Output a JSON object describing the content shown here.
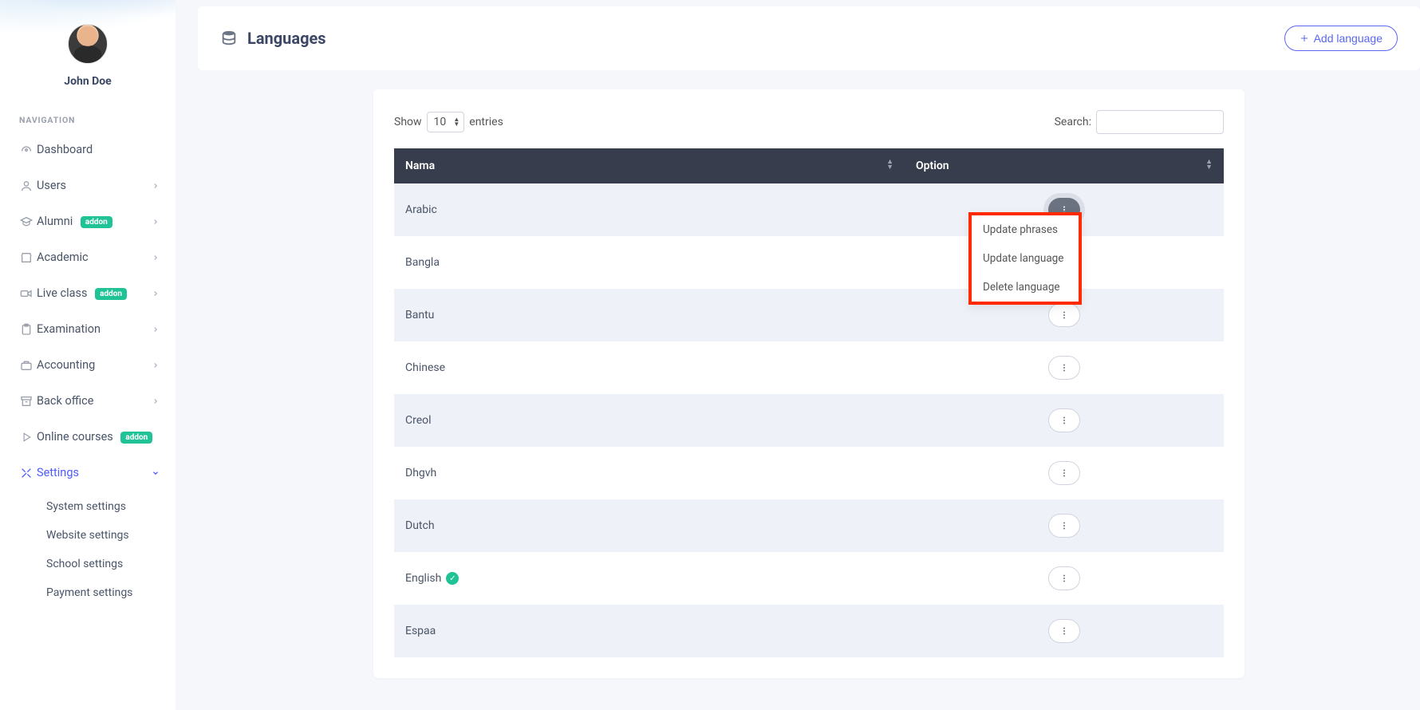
{
  "profile": {
    "name": "John Doe"
  },
  "navHeading": "NAVIGATION",
  "addonText": "addon",
  "nav": {
    "dashboard": "Dashboard",
    "users": "Users",
    "alumni": "Alumni",
    "academic": "Academic",
    "liveClass": "Live class",
    "examination": "Examination",
    "accounting": "Accounting",
    "backOffice": "Back office",
    "onlineCourses": "Online courses",
    "settings": "Settings"
  },
  "subnav": {
    "system": "System settings",
    "website": "Website settings",
    "school": "School settings",
    "payment": "Payment settings"
  },
  "header": {
    "title": "Languages",
    "addButton": "Add language"
  },
  "tableControls": {
    "showLabel": "Show",
    "entriesLabel": "entries",
    "lengthValue": "10",
    "searchLabel": "Search:"
  },
  "columns": {
    "name": "Nama",
    "option": "Option"
  },
  "dropdown": {
    "updatePhrases": "Update phrases",
    "updateLanguage": "Update language",
    "deleteLanguage": "Delete language"
  },
  "rows": [
    {
      "name": "Arabic",
      "default": false,
      "open": true
    },
    {
      "name": "Bangla",
      "default": false,
      "open": false
    },
    {
      "name": "Bantu",
      "default": false,
      "open": false
    },
    {
      "name": "Chinese",
      "default": false,
      "open": false
    },
    {
      "name": "Creol",
      "default": false,
      "open": false
    },
    {
      "name": "Dhgvh",
      "default": false,
      "open": false
    },
    {
      "name": "Dutch",
      "default": false,
      "open": false
    },
    {
      "name": "English",
      "default": true,
      "open": false
    },
    {
      "name": "Espaa",
      "default": false,
      "open": false
    }
  ]
}
